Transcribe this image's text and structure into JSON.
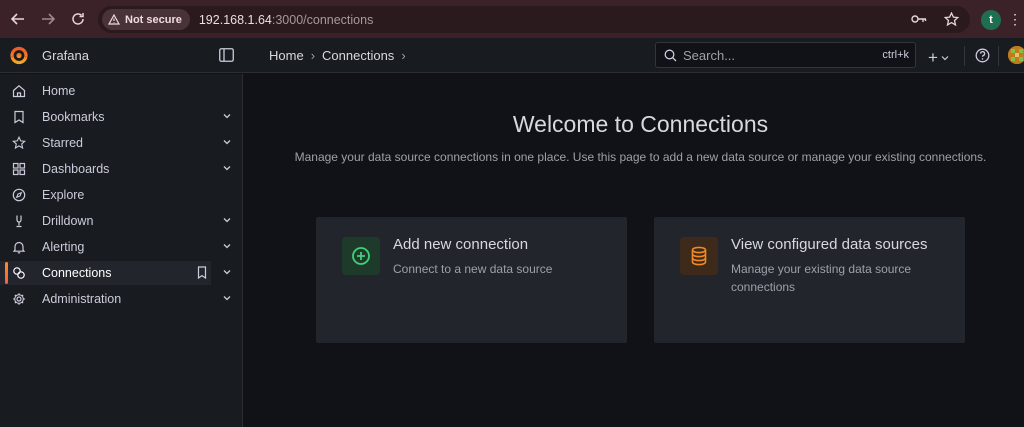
{
  "browser": {
    "security_label": "Not secure",
    "url_host": "192.168.1.64",
    "url_path": ":3000/connections",
    "profile_initial": "t"
  },
  "header": {
    "brand": "Grafana",
    "breadcrumbs": [
      "Home",
      "Connections"
    ],
    "search_placeholder": "Search...",
    "search_shortcut": "ctrl+k",
    "plus_label": "+"
  },
  "sidebar": {
    "items": [
      {
        "label": "Home",
        "icon": "home-icon",
        "chevron": false
      },
      {
        "label": "Bookmarks",
        "icon": "bookmark-icon",
        "chevron": true
      },
      {
        "label": "Starred",
        "icon": "star-icon",
        "chevron": true
      },
      {
        "label": "Dashboards",
        "icon": "apps-icon",
        "chevron": true
      },
      {
        "label": "Explore",
        "icon": "compass-icon",
        "chevron": false
      },
      {
        "label": "Drilldown",
        "icon": "drilldown-icon",
        "chevron": true
      },
      {
        "label": "Alerting",
        "icon": "bell-icon",
        "chevron": true
      },
      {
        "label": "Connections",
        "icon": "connections-icon",
        "chevron": true,
        "active": true
      },
      {
        "label": "Administration",
        "icon": "cog-icon",
        "chevron": true
      }
    ]
  },
  "main": {
    "title": "Welcome to Connections",
    "subtitle": "Manage your data source connections in one place. Use this page to add a new data source or manage your existing connections.",
    "cards": [
      {
        "title": "Add new connection",
        "desc": "Connect to a new data source",
        "icon": "plus-circle-icon",
        "accent": "#3fd17a"
      },
      {
        "title": "View configured data sources",
        "desc": "Manage your existing data source connections",
        "icon": "database-icon",
        "accent": "#f08a24"
      }
    ]
  },
  "colors": {
    "accent": "#f55f3e",
    "browser_bar": "#3b2228"
  }
}
